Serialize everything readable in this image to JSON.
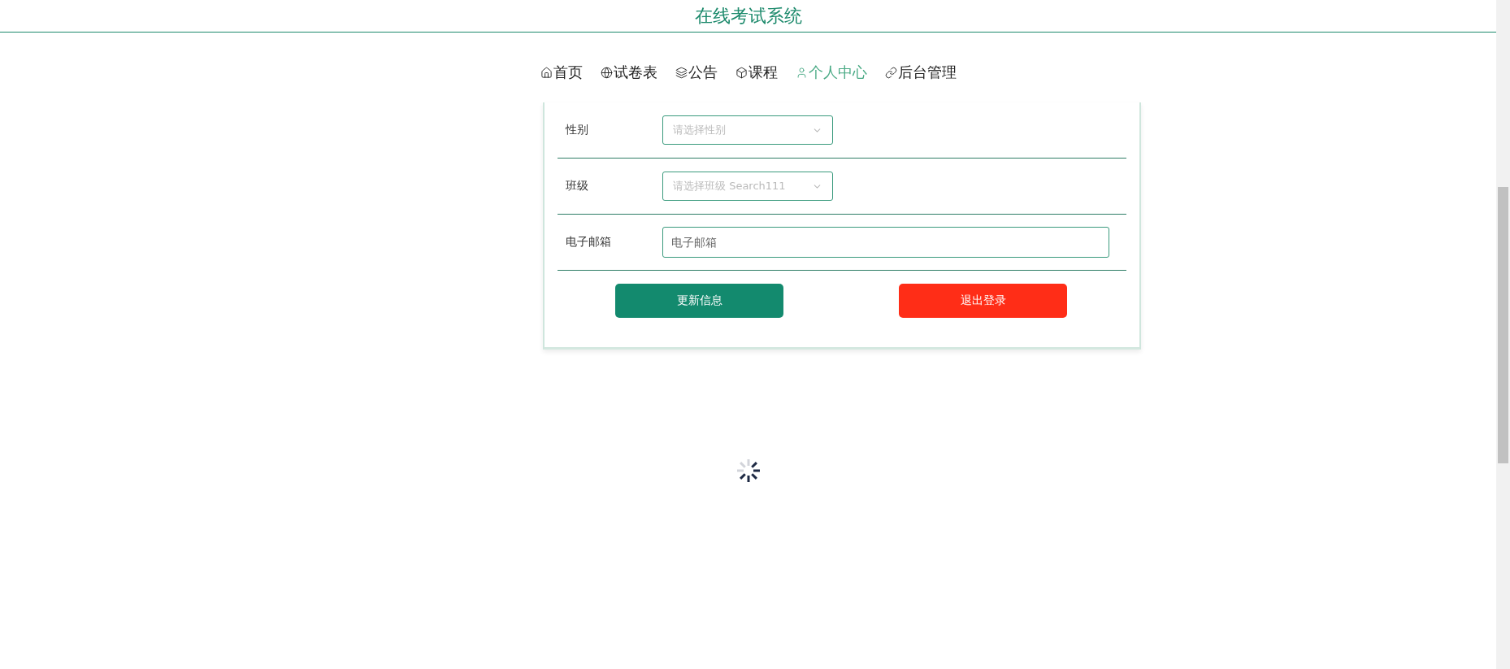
{
  "header": {
    "title": "在线考试系统"
  },
  "nav": [
    {
      "label": "首页",
      "selected": false
    },
    {
      "label": "试卷表",
      "selected": false
    },
    {
      "label": "公告",
      "selected": false
    },
    {
      "label": "课程",
      "selected": false
    },
    {
      "label": "个人中心",
      "selected": true
    },
    {
      "label": "后台管理",
      "selected": false
    }
  ],
  "form": {
    "fields": [
      {
        "kind": "select",
        "label": "性别",
        "placeholder": "请选择性别"
      },
      {
        "kind": "select",
        "label": "班级",
        "placeholder": "请选择班级 Search111"
      },
      {
        "kind": "input",
        "label": "电子邮箱",
        "placeholder": "电子邮箱"
      }
    ],
    "buttons": [
      {
        "label": "更新信息",
        "kind": "primary"
      },
      {
        "label": "退出登录",
        "kind": "danger"
      }
    ]
  }
}
